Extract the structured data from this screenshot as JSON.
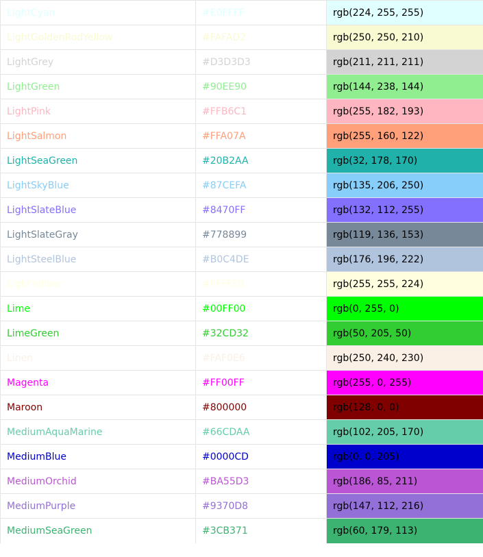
{
  "colors": [
    {
      "name": "LightCyan",
      "hex": "#E0FFFF",
      "rgb": "rgb(224, 255, 255)"
    },
    {
      "name": "LightGoldenRodYellow",
      "hex": "#FAFAD2",
      "rgb": "rgb(250, 250, 210)"
    },
    {
      "name": "LightGrey",
      "hex": "#D3D3D3",
      "rgb": "rgb(211, 211, 211)"
    },
    {
      "name": "LightGreen",
      "hex": "#90EE90",
      "rgb": "rgb(144, 238, 144)"
    },
    {
      "name": "LightPink",
      "hex": "#FFB6C1",
      "rgb": "rgb(255, 182, 193)"
    },
    {
      "name": "LightSalmon",
      "hex": "#FFA07A",
      "rgb": "rgb(255, 160, 122)"
    },
    {
      "name": "LightSeaGreen",
      "hex": "#20B2AA",
      "rgb": "rgb(32, 178, 170)"
    },
    {
      "name": "LightSkyBlue",
      "hex": "#87CEFA",
      "rgb": "rgb(135, 206, 250)"
    },
    {
      "name": "LightSlateBlue",
      "hex": "#8470FF",
      "rgb": "rgb(132, 112, 255)"
    },
    {
      "name": "LightSlateGray",
      "hex": "#778899",
      "rgb": "rgb(119, 136, 153)"
    },
    {
      "name": "LightSteelBlue",
      "hex": "#B0C4DE",
      "rgb": "rgb(176, 196, 222)"
    },
    {
      "name": "LightYellow",
      "hex": "#FFFFE0",
      "rgb": "rgb(255, 255, 224)"
    },
    {
      "name": "Lime",
      "hex": "#00FF00",
      "rgb": "rgb(0, 255, 0)"
    },
    {
      "name": "LimeGreen",
      "hex": "#32CD32",
      "rgb": "rgb(50, 205, 50)"
    },
    {
      "name": "Linen",
      "hex": "#FAF0E6",
      "rgb": "rgb(250, 240, 230)"
    },
    {
      "name": "Magenta",
      "hex": "#FF00FF",
      "rgb": "rgb(255, 0, 255)"
    },
    {
      "name": "Maroon",
      "hex": "#800000",
      "rgb": "rgb(128, 0, 0)"
    },
    {
      "name": "MediumAquaMarine",
      "hex": "#66CDAA",
      "rgb": "rgb(102, 205, 170)"
    },
    {
      "name": "MediumBlue",
      "hex": "#0000CD",
      "rgb": "rgb(0, 0, 205)"
    },
    {
      "name": "MediumOrchid",
      "hex": "#BA55D3",
      "rgb": "rgb(186, 85, 211)"
    },
    {
      "name": "MediumPurple",
      "hex": "#9370D8",
      "rgb": "rgb(147, 112, 216)"
    },
    {
      "name": "MediumSeaGreen",
      "hex": "#3CB371",
      "rgb": "rgb(60, 179, 113)"
    }
  ]
}
